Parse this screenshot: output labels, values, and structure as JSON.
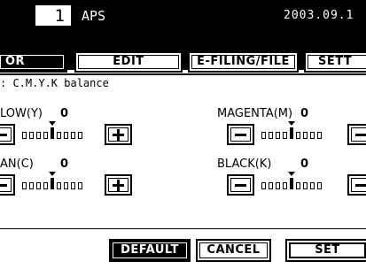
{
  "status": {
    "copy_count": "1",
    "mode": "APS",
    "date": "2003.09.1"
  },
  "tabs": {
    "color": "OR",
    "edit": "EDIT",
    "efiling": "E-FILING/FILE",
    "setting": "SETT"
  },
  "panel": {
    "subtitle": ": C.M.Y.K balance",
    "yellow": {
      "label": "LOW(Y)",
      "value": "0"
    },
    "magenta": {
      "label": "MAGENTA(M)",
      "value": "0"
    },
    "cyan": {
      "label": "AN(C)",
      "value": "0"
    },
    "black": {
      "label": "BLACK(K)",
      "value": "0"
    }
  },
  "buttons": {
    "default": "DEFAULT",
    "cancel": "CANCEL",
    "set": "SET"
  }
}
